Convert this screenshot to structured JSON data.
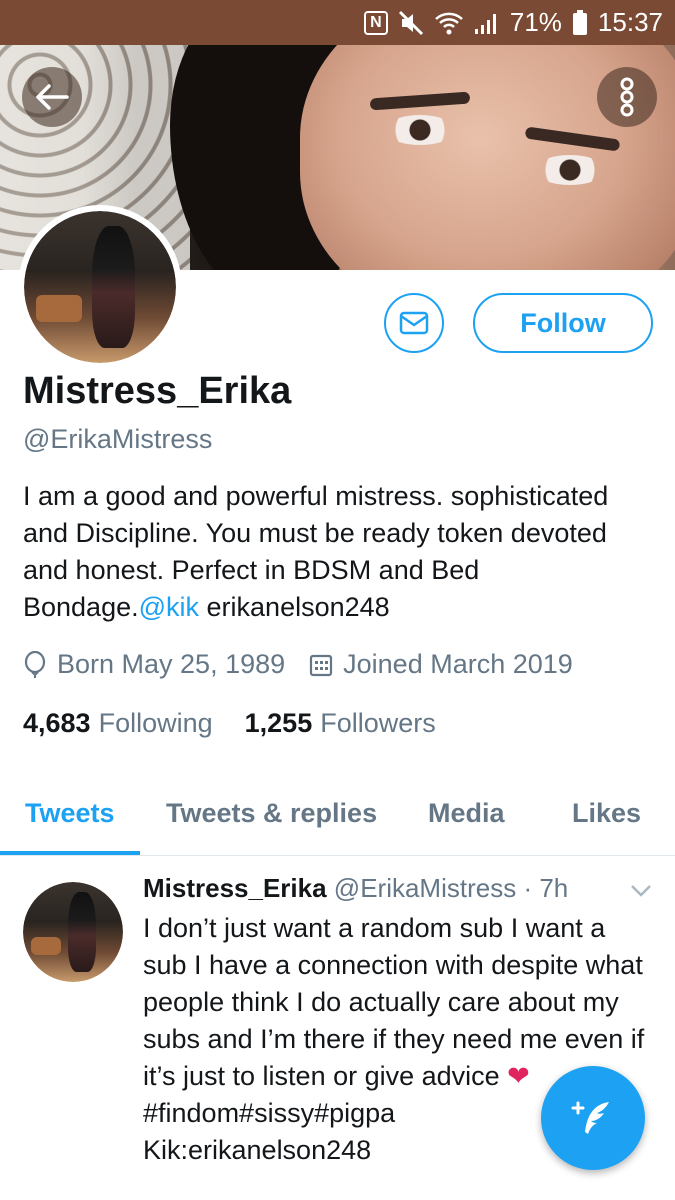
{
  "status_bar": {
    "battery": "71%",
    "time": "15:37",
    "nfc": "N"
  },
  "profile": {
    "display_name": "Mistress_Erika",
    "handle": "@ErikaMistress",
    "bio_text": "I am a good and powerful mistress. sophisticated and Discipline. You must be ready token devoted and honest. Perfect in BDSM and Bed Bondage.",
    "bio_link": "@kik",
    "bio_tail": " erikanelson248",
    "born": "Born May 25, 1989",
    "joined": "Joined March 2019",
    "following_count": "4,683",
    "following_label": "Following",
    "followers_count": "1,255",
    "followers_label": "Followers"
  },
  "actions": {
    "follow_label": "Follow",
    "message_icon": "envelope-icon"
  },
  "tabs": [
    {
      "label": "Tweets",
      "active": true
    },
    {
      "label": "Tweets & replies",
      "active": false
    },
    {
      "label": "Media",
      "active": false
    },
    {
      "label": "Likes",
      "active": false
    }
  ],
  "tweet": {
    "author_name": "Mistress_Erika",
    "author_handle": "@ErikaMistress",
    "time": "· 7h",
    "text_before_heart": "I don’t just want a random sub I want a sub I have a connection with despite what people think I do actually care about my subs and I’m there if they need me even if it’s just to listen or give advice ",
    "heart": "❤",
    "text_after_heart": " #findom#sissy#pigpa",
    "text_line_last": "Kik:erikanelson248"
  },
  "colors": {
    "accent": "#1da1f2",
    "status_bar": "#7a4a35",
    "secondary_text": "#657786",
    "heart": "#e0245e"
  }
}
